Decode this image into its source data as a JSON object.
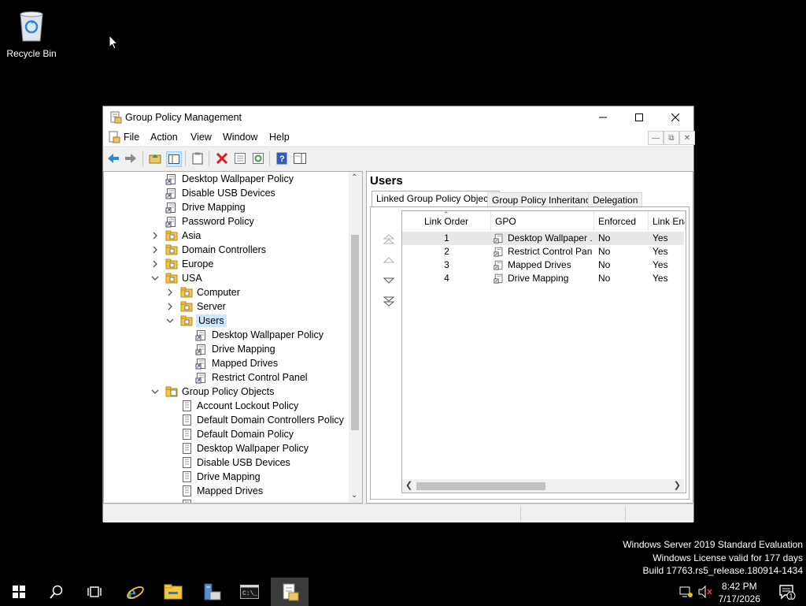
{
  "desktop": {
    "recycle_bin_label": "Recycle Bin"
  },
  "watermark": {
    "line1": "Windows Server 2019 Standard Evaluation",
    "line2": "Windows License valid for 177 days",
    "line3": "Build 17763.rs5_release.180914-1434"
  },
  "window": {
    "title": "Group Policy Management",
    "menu": [
      "File",
      "Action",
      "View",
      "Window",
      "Help"
    ]
  },
  "tree": {
    "items": [
      {
        "label": "Desktop Wallpaper Policy",
        "type": "link"
      },
      {
        "label": "Disable USB Devices",
        "type": "link"
      },
      {
        "label": "Drive Mapping",
        "type": "link"
      },
      {
        "label": "Password Policy",
        "type": "link"
      },
      {
        "label": "Asia",
        "type": "ou"
      },
      {
        "label": "Domain Controllers",
        "type": "ou"
      },
      {
        "label": "Europe",
        "type": "ou"
      },
      {
        "label": "USA",
        "type": "ou"
      },
      {
        "label": "Computer",
        "type": "ou"
      },
      {
        "label": "Server",
        "type": "ou"
      },
      {
        "label": "Users",
        "type": "ou"
      },
      {
        "label": "Desktop Wallpaper Policy",
        "type": "link"
      },
      {
        "label": "Drive Mapping",
        "type": "link"
      },
      {
        "label": "Mapped Drives",
        "type": "link"
      },
      {
        "label": "Restrict Control Panel",
        "type": "link"
      },
      {
        "label": "Group Policy Objects",
        "type": "folder"
      },
      {
        "label": "Account Lockout Policy",
        "type": "gpo"
      },
      {
        "label": "Default Domain Controllers Policy",
        "type": "gpo"
      },
      {
        "label": "Default Domain Policy",
        "type": "gpo"
      },
      {
        "label": "Desktop Wallpaper Policy",
        "type": "gpo"
      },
      {
        "label": "Disable USB Devices",
        "type": "gpo"
      },
      {
        "label": "Drive Mapping",
        "type": "gpo"
      },
      {
        "label": "Mapped Drives",
        "type": "gpo"
      }
    ],
    "selected": "Users"
  },
  "details": {
    "title": "Users",
    "tabs": [
      "Linked Group Policy Objects",
      "Group Policy Inheritance",
      "Delegation"
    ],
    "active_tab": "Linked Group Policy Objects",
    "columns": [
      "Link Order",
      "GPO",
      "Enforced",
      "Link Ena"
    ],
    "rows": [
      {
        "order": "1",
        "gpo": "Desktop Wallpaper ...",
        "enforced": "No",
        "enabled": "Yes"
      },
      {
        "order": "2",
        "gpo": "Restrict Control Panel",
        "enforced": "No",
        "enabled": "Yes"
      },
      {
        "order": "3",
        "gpo": "Mapped Drives",
        "enforced": "No",
        "enabled": "Yes"
      },
      {
        "order": "4",
        "gpo": "Drive Mapping",
        "enforced": "No",
        "enabled": "Yes"
      }
    ]
  },
  "taskbar": {
    "time": "8:42 PM",
    "date": "7/17/2026",
    "notification_count": "1"
  }
}
